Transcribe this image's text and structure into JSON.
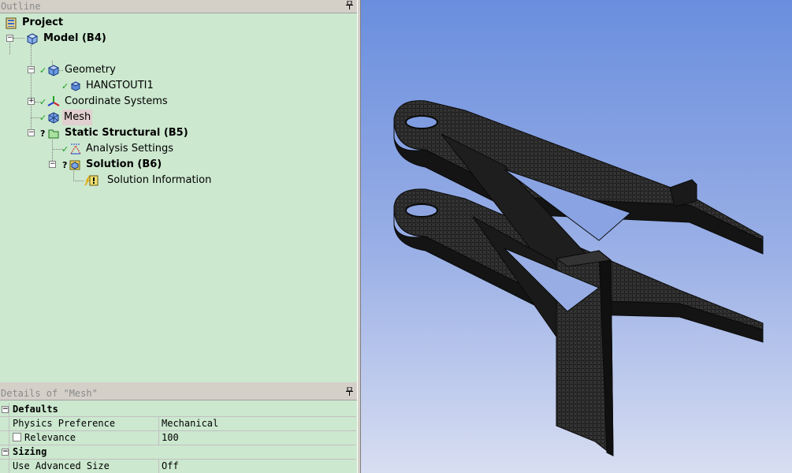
{
  "outline": {
    "title": "Outline",
    "pin_glyph": "📌",
    "tree": {
      "project": "Project",
      "model": "Model (B4)",
      "geometry": "Geometry",
      "part": "HANGTOUTI1",
      "coordinate_systems": "Coordinate Systems",
      "mesh": "Mesh",
      "static_structural": "Static Structural (B5)",
      "analysis_settings": "Analysis Settings",
      "solution": "Solution (B6)",
      "solution_information": "Solution Information"
    }
  },
  "details": {
    "title": "Details of \"Mesh\"",
    "groups": [
      {
        "name": "Defaults",
        "rows": [
          {
            "key": "Physics Preference",
            "value": "Mechanical"
          },
          {
            "key": "Relevance",
            "value": "100"
          }
        ]
      },
      {
        "name": "Sizing",
        "rows": [
          {
            "key": "Use Advanced Size Function",
            "value": "Off"
          }
        ]
      }
    ]
  },
  "viewport": {
    "model_color": "#1c1c1c",
    "background_top": "#6a8ede",
    "background_bottom": "#d8def2"
  }
}
